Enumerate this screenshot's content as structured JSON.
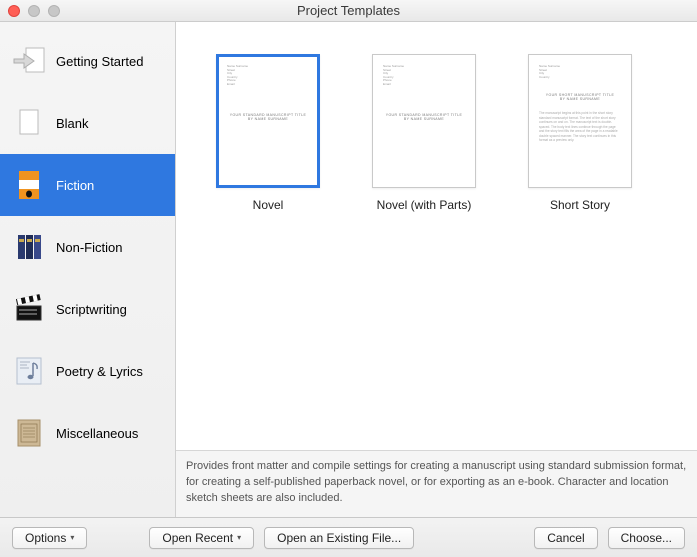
{
  "window_title": "Project Templates",
  "sidebar": {
    "items": [
      {
        "label": "Getting Started"
      },
      {
        "label": "Blank"
      },
      {
        "label": "Fiction"
      },
      {
        "label": "Non-Fiction"
      },
      {
        "label": "Scriptwriting"
      },
      {
        "label": "Poetry & Lyrics"
      },
      {
        "label": "Miscellaneous"
      }
    ],
    "selected_index": 2
  },
  "templates": {
    "items": [
      {
        "label": "Novel"
      },
      {
        "label": "Novel (with Parts)"
      },
      {
        "label": "Short Story"
      }
    ],
    "selected_index": 0
  },
  "description": "Provides front matter and compile settings for creating a manuscript using standard submission format, for creating a self-published paperback novel, or for exporting as an e-book. Character and location sketch sheets are also included.",
  "footer": {
    "options": "Options",
    "open_recent": "Open Recent",
    "open_existing": "Open an Existing File...",
    "cancel": "Cancel",
    "choose": "Choose..."
  }
}
